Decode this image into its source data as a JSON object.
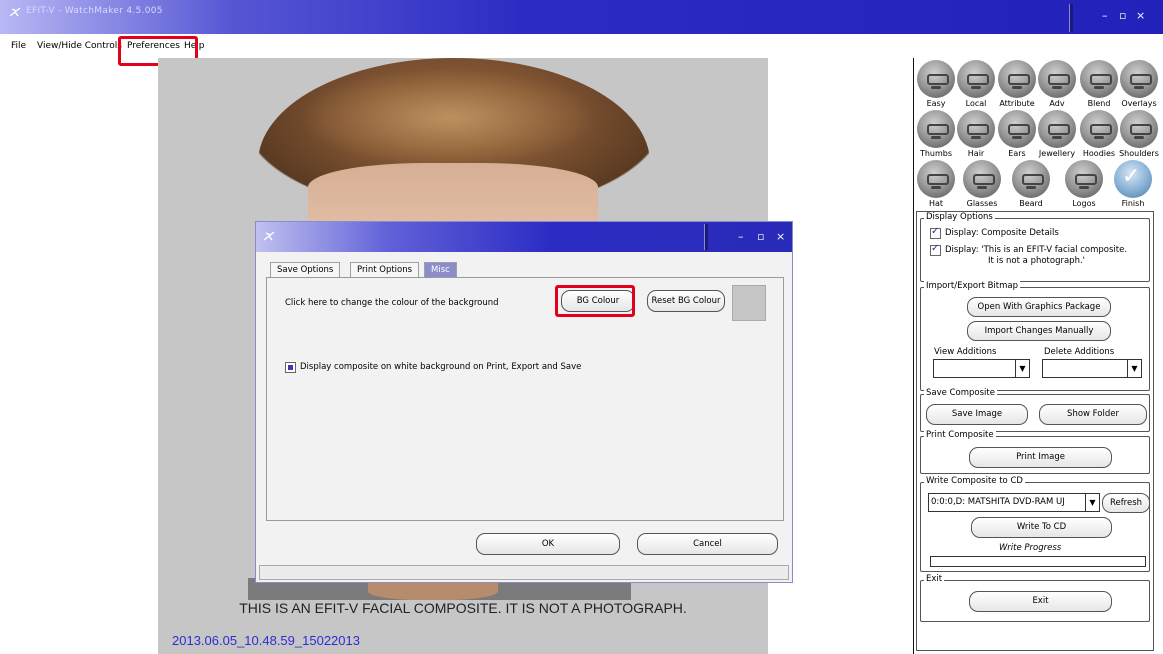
{
  "app": {
    "title": "EFIT-V - WatchMaker 4.5.005",
    "controls": [
      "–",
      "▫",
      "×"
    ]
  },
  "menu": {
    "items": [
      "File",
      "View/Hide Controls",
      "Preferences",
      "Help"
    ]
  },
  "canvas": {
    "disclaimer": "THIS IS AN EFIT-V FACIAL COMPOSITE. IT IS NOT A PHOTOGRAPH.",
    "stamp": "2013.06.05_10.48.59_15022013"
  },
  "dialog": {
    "controls": [
      "–",
      "▫",
      "×"
    ],
    "tabs": [
      "Save Options",
      "Print Options",
      "Misc"
    ],
    "active_tab": "Misc",
    "bg_text": "Click here to change the colour of the background",
    "bg_colour_button": "BG Colour",
    "reset_bg_button": "Reset BG Colour",
    "swatch_color": "#c6c6c6",
    "white_bg_checkbox": "Display composite on white background on Print, Export and Save",
    "white_bg_checked": true,
    "ok_button": "OK",
    "cancel_button": "Cancel"
  },
  "tools": {
    "row1": [
      "Easy",
      "Local",
      "Attribute",
      "Adv",
      "Blend",
      "Overlays"
    ],
    "row2": [
      "Thumbs",
      "Hair",
      "Ears",
      "Jewellery",
      "Hoodies",
      "Shoulders"
    ],
    "row3": [
      "Hat",
      "Glasses",
      "Beard",
      "Logos",
      "Finish"
    ]
  },
  "panel": {
    "display_options": {
      "legend": "Display Options",
      "composite_details": "Display: Composite Details",
      "composite_details_checked": true,
      "efit_notice_1": "Display: 'This is an EFIT-V facial composite.",
      "efit_notice_2": "It is not a photograph.'",
      "efit_notice_checked": true
    },
    "import_export": {
      "legend": "Import/Export Bitmap",
      "open_graphics": "Open With Graphics Package",
      "import_changes": "Import Changes Manually",
      "view_additions": "View Additions",
      "delete_additions": "Delete Additions"
    },
    "save_composite": {
      "legend": "Save Composite",
      "save_image": "Save Image",
      "show_folder": "Show Folder"
    },
    "print_composite": {
      "legend": "Print Composite",
      "print_image": "Print Image"
    },
    "write_cd": {
      "legend": "Write Composite to CD",
      "drive": "0:0:0,D: MATSHITA DVD-RAM UJ",
      "refresh": "Refresh",
      "write_button": "Write To CD",
      "progress_label": "Write Progress",
      "progress": 0
    },
    "exit": {
      "legend": "Exit",
      "exit_button": "Exit"
    }
  },
  "highlight_color": "#e3001b"
}
